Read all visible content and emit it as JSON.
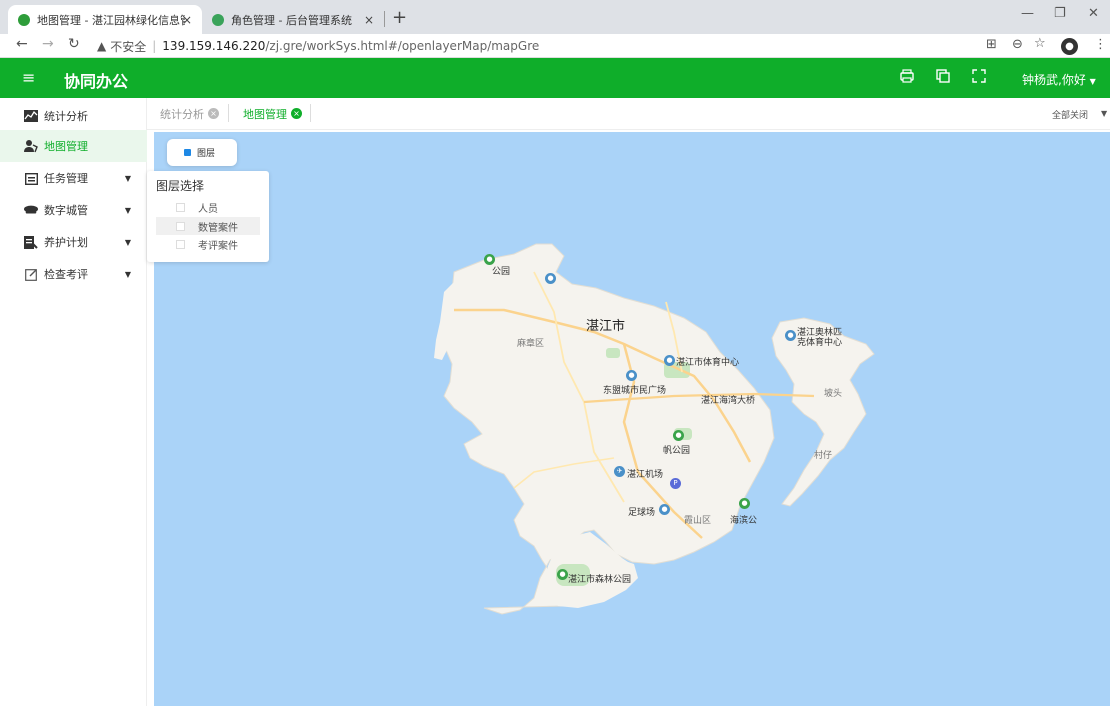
{
  "browser": {
    "tabs": [
      {
        "title": "地图管理 - 湛江园林绿化信息管理",
        "close": "×",
        "active": true
      },
      {
        "title": "角色管理 - 后台管理系统",
        "close": "×",
        "active": false
      }
    ],
    "new_tab": "+",
    "url": {
      "security": "不安全",
      "host": "139.159.146.220",
      "path": "/zj.gre/workSys.html#/openlayerMap/mapGre"
    }
  },
  "app": {
    "title": "协同办公",
    "user_greeting": "钟杨武,你好"
  },
  "sidebar": {
    "items": [
      {
        "label": "统计分析",
        "icon": "chart-icon",
        "has_arrow": false,
        "active": false
      },
      {
        "label": "地图管理",
        "icon": "map-user-icon",
        "has_arrow": false,
        "active": true
      },
      {
        "label": "任务管理",
        "icon": "calendar-icon",
        "has_arrow": true,
        "active": false
      },
      {
        "label": "数字城管",
        "icon": "police-cap-icon",
        "has_arrow": true,
        "active": false
      },
      {
        "label": "养护计划",
        "icon": "plan-icon",
        "has_arrow": true,
        "active": false
      },
      {
        "label": "检查考评",
        "icon": "edit-icon",
        "has_arrow": true,
        "active": false
      }
    ]
  },
  "content_tabs": {
    "tabs": [
      {
        "label": "统计分析",
        "active": false
      },
      {
        "label": "地图管理",
        "active": true
      }
    ],
    "close_all": "全部关闭"
  },
  "layer_control": {
    "button_label": "图层",
    "panel_title": "图层选择",
    "options": [
      {
        "label": "人员",
        "checked": false
      },
      {
        "label": "数管案件",
        "checked": false
      },
      {
        "label": "考评案件",
        "checked": false
      }
    ]
  },
  "map": {
    "labels": {
      "city": "湛江市",
      "mazhang": "麻章区",
      "xiashan": "霞山区",
      "potou": "坡头",
      "stadium": "湛江市体育中心",
      "square": "东盟城市民广场",
      "bridge": "湛江海湾大桥",
      "sail_park": "帆公园",
      "airport": "湛江机场",
      "football": "足球场",
      "seaside": "海滨公",
      "forest_park": "湛江市森林公园",
      "olympic": "湛江奥林匹克体育中心",
      "park_top": "公园",
      "village": "村仔"
    }
  },
  "colors": {
    "brand": "#0fae2a",
    "water": "#aad3f8",
    "land": "#f5f3ee",
    "park": "#c8e6c0"
  }
}
